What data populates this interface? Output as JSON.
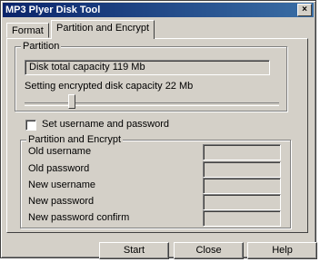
{
  "window": {
    "title": "MP3 Plyer Disk Tool",
    "close_glyph": "×"
  },
  "tabs": [
    {
      "label": "Format"
    },
    {
      "label": "Partition and Encrypt"
    }
  ],
  "partition": {
    "group_label": "Partition",
    "total_capacity_text": "Disk total capacity 119 Mb",
    "encrypted_capacity_text": "Setting encrypted disk capacity 22 Mb",
    "slider_value_mb": 22,
    "slider_max_mb": 119
  },
  "credentials_checkbox": {
    "label": "Set username and password",
    "checked": false
  },
  "encrypt_group": {
    "group_label": "Partition and Encrypt",
    "fields": [
      {
        "label": "Old username",
        "value": ""
      },
      {
        "label": "Old password",
        "value": ""
      },
      {
        "label": "New username",
        "value": ""
      },
      {
        "label": "New password",
        "value": ""
      },
      {
        "label": "New password confirm",
        "value": ""
      }
    ]
  },
  "buttons": {
    "start": "Start",
    "close": "Close",
    "help": "Help"
  }
}
